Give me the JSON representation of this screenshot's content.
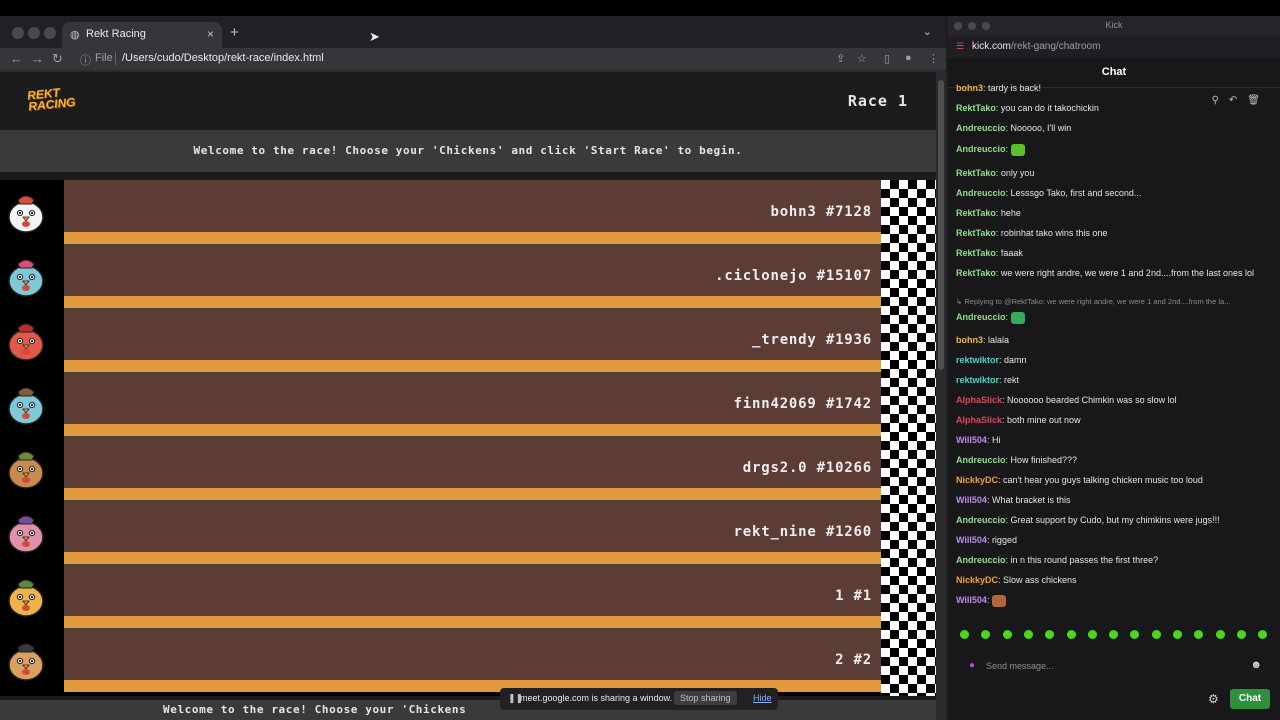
{
  "browser": {
    "tab_title": "Rekt Racing",
    "file_label": "File",
    "url": "/Users/cudo/Desktop/rekt-race/index.html"
  },
  "game": {
    "logo_text": "REKT RACING",
    "race_label": "Race 1",
    "welcome": "Welcome to the race! Choose your 'Chickens' and click 'Start Race' to begin.",
    "welcome_bottom": "Welcome to the race! Choose your 'Chickens",
    "lanes": [
      {
        "name": "bohn3 #7128",
        "chicken_color": "#f5f5f5",
        "accent": "#d94b3a"
      },
      {
        "name": ".ciclonejo #15107",
        "chicken_color": "#7ec8d8",
        "accent": "#d94b7a"
      },
      {
        "name": "_trendy #1936",
        "chicken_color": "#e05a4a",
        "accent": "#b82e2e"
      },
      {
        "name": "finn42069 #1742",
        "chicken_color": "#7ec8d8",
        "accent": "#8a5a3a"
      },
      {
        "name": "drgs2.0 #10266",
        "chicken_color": "#c98a50",
        "accent": "#6e8a3a"
      },
      {
        "name": "rekt_nine #1260",
        "chicken_color": "#e090a8",
        "accent": "#7a4aa0"
      },
      {
        "name": "1 #1",
        "chicken_color": "#f0b24a",
        "accent": "#5a8a3a"
      },
      {
        "name": "2 #2",
        "chicken_color": "#d9a060",
        "accent": "#3a3a3a"
      }
    ]
  },
  "share_bar": {
    "message": "meet.google.com is sharing a window.",
    "stop_label": "Stop sharing",
    "hide_label": "Hide"
  },
  "kick": {
    "window_title": "Kick",
    "url_domain": "kick.com",
    "url_path": "/rekt-gang/chatroom",
    "chat_title": "Chat",
    "placeholder": "Send message...",
    "chat_button": "Chat",
    "messages": [
      {
        "user": "bohn3",
        "text": ": tardy is back!",
        "color": "#f2b63a"
      },
      {
        "user": "RektTako",
        "text": ": you can do it takochickin",
        "color": "#8fe08a"
      },
      {
        "user": "Andreuccio",
        "text": ": Nooooo, I'll win",
        "color": "#8fe08a"
      },
      {
        "user": "Andreuccio",
        "text": ": ",
        "color": "#8fe08a",
        "emote": "#5bbf2a"
      },
      {
        "user": "RektTako",
        "text": ": only you",
        "color": "#8fe08a"
      },
      {
        "user": "Andreuccio",
        "text": ": Lesssgo Tako, first and second...",
        "color": "#8fe08a"
      },
      {
        "user": "RektTako",
        "text": ": hehe",
        "color": "#8fe08a"
      },
      {
        "user": "RektTako",
        "text": ": robinhat tako wins this one",
        "color": "#8fe08a"
      },
      {
        "user": "RektTako",
        "text": ": faaak",
        "color": "#8fe08a"
      },
      {
        "user": "RektTako",
        "text": ": we were right andre, we were 1 and 2nd....from the last ones lol",
        "color": "#8fe08a"
      },
      {
        "reply": "↳ Replying to @RektTako: we were right andre, we were 1 and 2nd....from the la..."
      },
      {
        "user": "Andreuccio",
        "text": ": ",
        "color": "#8fe08a",
        "emote": "#3aa85a"
      },
      {
        "user": "bohn3",
        "text": ": lalala",
        "color": "#f2b63a"
      },
      {
        "user": "rektwiktor",
        "text": ": damn",
        "color": "#4fd0c8"
      },
      {
        "user": "rektwiktor",
        "text": ": rekt",
        "color": "#4fd0c8"
      },
      {
        "user": "AlphaSlick",
        "text": ": Noooooo bearded Chimkin was so slow lol",
        "color": "#e0455a"
      },
      {
        "user": "AlphaSlick",
        "text": ": both mine out now",
        "color": "#e0455a"
      },
      {
        "user": "Will504",
        "text": ": Hi",
        "color": "#c08ae8"
      },
      {
        "user": "Andreuccio",
        "text": ": How finished???",
        "color": "#8fe08a"
      },
      {
        "user": "NickkyDC",
        "text": ": can't hear you guys talking chicken music too loud",
        "color": "#f2a03a"
      },
      {
        "user": "Will504",
        "text": ": What bracket is this",
        "color": "#c08ae8"
      },
      {
        "user": "Andreuccio",
        "text": ": Great support by Cudo, but my chimkins were jugs!!!",
        "color": "#8fe08a"
      },
      {
        "user": "Will504",
        "text": ": rigged",
        "color": "#c08ae8"
      },
      {
        "user": "Andreuccio",
        "text": ": in n this round passes the first three?",
        "color": "#8fe08a"
      },
      {
        "user": "NickkyDC",
        "text": ": Slow ass chickens",
        "color": "#f2a03a"
      },
      {
        "user": "Will504",
        "text": ": ",
        "color": "#c08ae8",
        "emote": "#b5653a"
      }
    ]
  }
}
